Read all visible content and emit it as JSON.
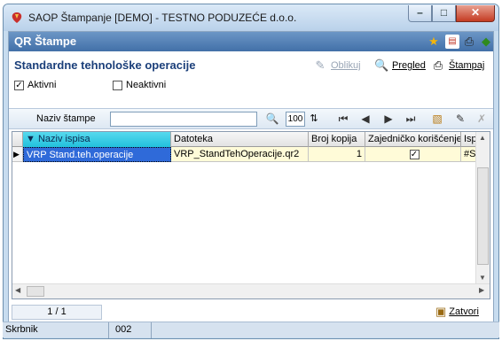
{
  "window": {
    "title": "SAOP Štampanje [DEMO] - TESTNO PODUZEĆE d.o.o."
  },
  "header": {
    "title": "QR Štampe"
  },
  "page": {
    "title": "Standardne tehnološke operacije"
  },
  "toolbar": {
    "design_label": "Oblikuj",
    "preview_label": "Pregled",
    "print_label": "Štampaj"
  },
  "filters": {
    "active_label": "Aktivni",
    "active_checked": true,
    "inactive_label": "Neaktivni",
    "inactive_checked": false
  },
  "search": {
    "label": "Naziv štampe",
    "value": "",
    "count": "100"
  },
  "grid": {
    "columns": [
      "Naziv ispisa",
      "Datoteka",
      "Broj kopija",
      "Zajedničko korišćenje",
      "Ispis d"
    ],
    "rows": [
      {
        "name": "VRP Stand.teh.operacije",
        "file": "VRP_StandTehOperacije.qr2",
        "copies": "1",
        "shared": true,
        "print": "#SAOF"
      }
    ]
  },
  "status": {
    "pager": "1 / 1",
    "close_label": "Zatvori"
  },
  "footer": {
    "label": "Skrbnik",
    "value": "002"
  },
  "colors": {
    "accent": "#4270a8",
    "title_text": "#1b3f7a",
    "selection": "#2f6ad9",
    "sorted_header": "#22c1dc"
  }
}
